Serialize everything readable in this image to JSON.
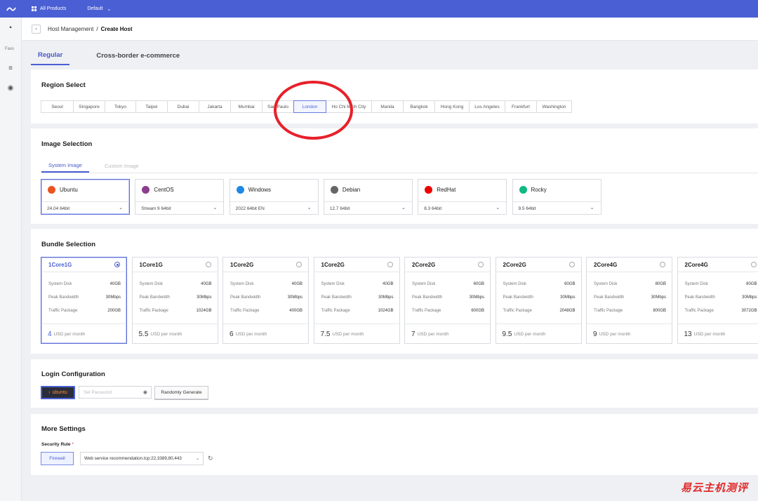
{
  "topbar": {
    "products_label": "All Products",
    "workspace_label": "Default"
  },
  "rail": {
    "favorites_label": "Favs"
  },
  "breadcrumb": {
    "parent": "Host Management",
    "separator": "/",
    "current": "Create Host"
  },
  "tabs": [
    {
      "label": "Regular",
      "active": true
    },
    {
      "label": "Cross-border e-commerce",
      "active": false
    }
  ],
  "region": {
    "title": "Region Select",
    "selected": "London",
    "items": [
      "Seoul",
      "Singapore",
      "Tokyo",
      "Taipei",
      "Dubai",
      "Jakarta",
      "Mumbai",
      "Sao Paulo",
      "London",
      "Ho Chi Minh City",
      "Manila",
      "Bangkok",
      "Hong Kong",
      "Los Angeles",
      "Frankfurt",
      "Washington"
    ]
  },
  "image": {
    "title": "Image Selection",
    "subtabs": [
      "System Image",
      "Custom Image"
    ],
    "items": [
      {
        "name": "Ubuntu",
        "version": "24.04 64bit",
        "color": "#e95420"
      },
      {
        "name": "CentOS",
        "version": "Stream 9 64bit",
        "color": "#8a3f8f"
      },
      {
        "name": "Windows",
        "version": "2022 64bit EN",
        "color": "#1e88e5"
      },
      {
        "name": "Debian",
        "version": "12.7 64bit",
        "color": "#666666"
      },
      {
        "name": "RedHat",
        "version": "8.3 64bit",
        "color": "#ee0000"
      },
      {
        "name": "Rocky",
        "version": "9.5 64bit",
        "color": "#10b981"
      }
    ]
  },
  "bundle": {
    "title": "Bundle Selection",
    "labels": {
      "disk": "System Disk",
      "bandwidth": "Peak Bandwidth",
      "traffic": "Traffic Package",
      "unit": "USD per month"
    },
    "items": [
      {
        "name": "1Core1G",
        "disk": "40GB",
        "bandwidth": "30Mbps",
        "traffic": "200GB",
        "price": "4",
        "selected": true
      },
      {
        "name": "1Core1G",
        "disk": "40GB",
        "bandwidth": "30Mbps",
        "traffic": "1024GB",
        "price": "5.5"
      },
      {
        "name": "1Core2G",
        "disk": "40GB",
        "bandwidth": "30Mbps",
        "traffic": "400GB",
        "price": "6"
      },
      {
        "name": "1Core2G",
        "disk": "40GB",
        "bandwidth": "30Mbps",
        "traffic": "1024GB",
        "price": "7.5"
      },
      {
        "name": "2Core2G",
        "disk": "60GB",
        "bandwidth": "30Mbps",
        "traffic": "600GB",
        "price": "7"
      },
      {
        "name": "2Core2G",
        "disk": "60GB",
        "bandwidth": "30Mbps",
        "traffic": "2048GB",
        "price": "9.5"
      },
      {
        "name": "2Core4G",
        "disk": "80GB",
        "bandwidth": "30Mbps",
        "traffic": "800GB",
        "price": "9"
      },
      {
        "name": "2Core4G",
        "disk": "80GB",
        "bandwidth": "30Mbps",
        "traffic": "3072GB",
        "price": "13"
      }
    ]
  },
  "login": {
    "title": "Login Configuration",
    "username": "ubuntu",
    "password_placeholder": "Set Password",
    "generate_label": "Randomly Generate"
  },
  "more": {
    "title": "More Settings",
    "security_label": "Security Rule",
    "required_mark": "*",
    "firewall_label": "Firewall",
    "rule_value": "Web service recommendation.tcp:22,3389,80,443"
  },
  "watermark": "易云主机测评"
}
